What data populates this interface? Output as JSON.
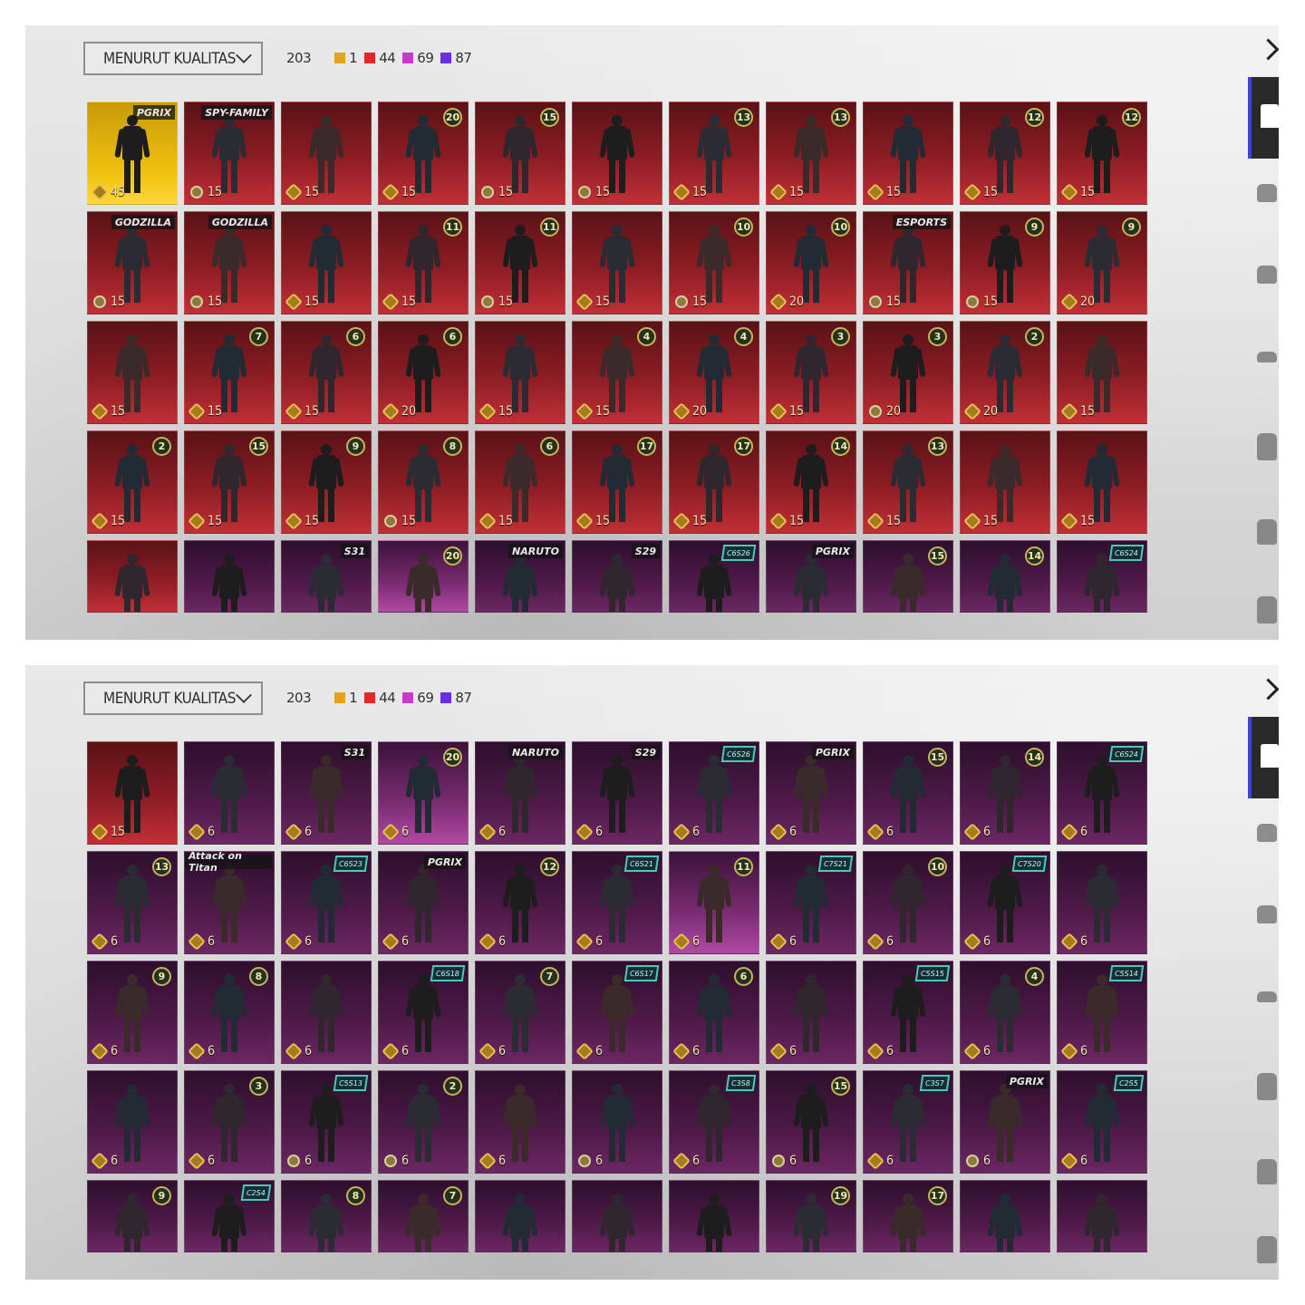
{
  "sort_label": "MENURUT KUALITAS",
  "summary": {
    "total": "203",
    "counts": [
      {
        "value": "1",
        "color": "#e8a21a"
      },
      {
        "value": "44",
        "color": "#e02828"
      },
      {
        "value": "69",
        "color": "#c43cc9"
      },
      {
        "value": "87",
        "color": "#6a2ee0"
      }
    ]
  },
  "colors": {
    "red": "#8d1d24",
    "purple": "#4f1a49",
    "gold": "#f0c20f",
    "accent_blue": "#3a46d8"
  },
  "sidebar_icons": [
    "shirt-icon",
    "helmet-icon",
    "cap-icon",
    "goggles-icon",
    "mask-icon",
    "jacket-icon",
    "backpack-icon"
  ],
  "panels": [
    {
      "id": "top",
      "tiles": [
        {
          "q": "gold",
          "price": "45",
          "tag": "PGRIX"
        },
        {
          "q": "red",
          "price": "15",
          "tag": "SPY-FAMILY",
          "coin": "round"
        },
        {
          "q": "red",
          "price": "15"
        },
        {
          "q": "red",
          "price": "15",
          "level": "20"
        },
        {
          "q": "red",
          "price": "15",
          "level": "15",
          "coin": "round"
        },
        {
          "q": "red",
          "price": "15",
          "coin": "round"
        },
        {
          "q": "red",
          "price": "15",
          "level": "13"
        },
        {
          "q": "red",
          "price": "15",
          "level": "13"
        },
        {
          "q": "red",
          "price": "15"
        },
        {
          "q": "red",
          "price": "15",
          "level": "12"
        },
        {
          "q": "red",
          "price": "15",
          "level": "12"
        },
        {
          "q": "red",
          "price": "15",
          "tag": "GODZILLA",
          "coin": "round"
        },
        {
          "q": "red",
          "price": "15",
          "tag": "GODZILLA",
          "coin": "round"
        },
        {
          "q": "red",
          "price": "15"
        },
        {
          "q": "red",
          "price": "15",
          "level": "11"
        },
        {
          "q": "red",
          "price": "15",
          "level": "11",
          "coin": "round"
        },
        {
          "q": "red",
          "price": "15"
        },
        {
          "q": "red",
          "price": "15",
          "level": "10",
          "coin": "round"
        },
        {
          "q": "red",
          "price": "20",
          "level": "10"
        },
        {
          "q": "red",
          "price": "15",
          "tag": "ESPORTS",
          "coin": "round"
        },
        {
          "q": "red",
          "price": "15",
          "level": "9",
          "coin": "round"
        },
        {
          "q": "red",
          "price": "20",
          "level": "9"
        },
        {
          "q": "red",
          "price": "15"
        },
        {
          "q": "red",
          "price": "15",
          "level": "7"
        },
        {
          "q": "red",
          "price": "15",
          "level": "6"
        },
        {
          "q": "red",
          "price": "20",
          "level": "6"
        },
        {
          "q": "red",
          "price": "15"
        },
        {
          "q": "red",
          "price": "15",
          "level": "4"
        },
        {
          "q": "red",
          "price": "20",
          "level": "4"
        },
        {
          "q": "red",
          "price": "15",
          "level": "3"
        },
        {
          "q": "red",
          "price": "20",
          "level": "3",
          "coin": "round"
        },
        {
          "q": "red",
          "price": "20",
          "level": "2"
        },
        {
          "q": "red",
          "price": "15"
        },
        {
          "q": "red",
          "price": "15",
          "level": "2"
        },
        {
          "q": "red",
          "price": "15",
          "level": "15"
        },
        {
          "q": "red",
          "price": "15",
          "level": "9"
        },
        {
          "q": "red",
          "price": "15",
          "level": "8",
          "coin": "round"
        },
        {
          "q": "red",
          "price": "15",
          "level": "6"
        },
        {
          "q": "red",
          "price": "15",
          "level": "17"
        },
        {
          "q": "red",
          "price": "15",
          "level": "17"
        },
        {
          "q": "red",
          "price": "15",
          "level": "14"
        },
        {
          "q": "red",
          "price": "15",
          "level": "13"
        },
        {
          "q": "red",
          "price": "15"
        },
        {
          "q": "red",
          "price": "15"
        },
        {
          "q": "red",
          "price": ""
        },
        {
          "q": "purple",
          "price": ""
        },
        {
          "q": "purple",
          "price": "",
          "tag": "S31"
        },
        {
          "q": "plight",
          "price": "",
          "level": "20"
        },
        {
          "q": "purple",
          "price": "",
          "tag": "NARUTO"
        },
        {
          "q": "purple",
          "price": "",
          "tag": "S29"
        },
        {
          "q": "purple",
          "price": "",
          "season": "C6S26"
        },
        {
          "q": "purple",
          "price": "",
          "tag": "PGRIX"
        },
        {
          "q": "purple",
          "price": "",
          "level": "15"
        },
        {
          "q": "purple",
          "price": "",
          "level": "14"
        },
        {
          "q": "purple",
          "price": "",
          "season": "C6S24"
        }
      ]
    },
    {
      "id": "bottom",
      "tiles": [
        {
          "q": "red",
          "price": "15"
        },
        {
          "q": "purple",
          "price": "6"
        },
        {
          "q": "purple",
          "price": "6",
          "tag": "S31"
        },
        {
          "q": "plight",
          "price": "6",
          "level": "20"
        },
        {
          "q": "purple",
          "price": "6",
          "tag": "NARUTO"
        },
        {
          "q": "purple",
          "price": "6",
          "tag": "S29"
        },
        {
          "q": "purple",
          "price": "6",
          "season": "C6S26"
        },
        {
          "q": "purple",
          "price": "6",
          "tag": "PGRIX"
        },
        {
          "q": "purple",
          "price": "6",
          "level": "15"
        },
        {
          "q": "purple",
          "price": "6",
          "level": "14"
        },
        {
          "q": "purple",
          "price": "6",
          "season": "C6S24"
        },
        {
          "q": "purple",
          "price": "6",
          "level": "13"
        },
        {
          "q": "purple",
          "price": "6",
          "tag": "Attack on Titan"
        },
        {
          "q": "purple",
          "price": "6",
          "season": "C6S23"
        },
        {
          "q": "purple",
          "price": "6",
          "tag": "PGRIX"
        },
        {
          "q": "purple",
          "price": "6",
          "level": "12"
        },
        {
          "q": "purple",
          "price": "6",
          "season": "C6S21"
        },
        {
          "q": "plight",
          "price": "6",
          "level": "11"
        },
        {
          "q": "purple",
          "price": "6",
          "season": "C7S21"
        },
        {
          "q": "purple",
          "price": "6",
          "level": "10"
        },
        {
          "q": "purple",
          "price": "6",
          "season": "C7S20"
        },
        {
          "q": "purple",
          "price": "6"
        },
        {
          "q": "purple",
          "price": "6",
          "level": "9"
        },
        {
          "q": "purple",
          "price": "6",
          "level": "8"
        },
        {
          "q": "purple",
          "price": "6"
        },
        {
          "q": "purple",
          "price": "6",
          "season": "C6S18"
        },
        {
          "q": "purple",
          "price": "6",
          "level": "7"
        },
        {
          "q": "purple",
          "price": "6",
          "season": "C6S17"
        },
        {
          "q": "purple",
          "price": "6",
          "level": "6"
        },
        {
          "q": "purple",
          "price": "6"
        },
        {
          "q": "purple",
          "price": "6",
          "season": "C5S15"
        },
        {
          "q": "purple",
          "price": "6",
          "level": "4"
        },
        {
          "q": "purple",
          "price": "6",
          "season": "C5S14"
        },
        {
          "q": "purple",
          "price": "6"
        },
        {
          "q": "purple",
          "price": "6",
          "level": "3"
        },
        {
          "q": "purple",
          "price": "6",
          "season": "C5S13",
          "coin": "round"
        },
        {
          "q": "purple",
          "price": "6",
          "level": "2",
          "coin": "round"
        },
        {
          "q": "purple",
          "price": "6"
        },
        {
          "q": "purple",
          "price": "6",
          "coin": "round"
        },
        {
          "q": "purple",
          "price": "6",
          "season": "C3S8"
        },
        {
          "q": "purple",
          "price": "6",
          "level": "15",
          "coin": "round"
        },
        {
          "q": "purple",
          "price": "6",
          "season": "C3S7"
        },
        {
          "q": "purple",
          "price": "6",
          "tag": "PGRIX",
          "coin": "round"
        },
        {
          "q": "purple",
          "price": "6",
          "season": "C2S5"
        },
        {
          "q": "purple",
          "price": "",
          "level": "9"
        },
        {
          "q": "purple",
          "price": "",
          "season": "C2S4"
        },
        {
          "q": "purple",
          "price": "",
          "level": "8"
        },
        {
          "q": "purple",
          "price": "",
          "level": "7"
        },
        {
          "q": "purple",
          "price": ""
        },
        {
          "q": "purple",
          "price": ""
        },
        {
          "q": "purple",
          "price": ""
        },
        {
          "q": "purple",
          "price": "",
          "level": "19"
        },
        {
          "q": "purple",
          "price": "",
          "level": "17"
        },
        {
          "q": "purple",
          "price": ""
        },
        {
          "q": "purple",
          "price": ""
        }
      ]
    }
  ]
}
